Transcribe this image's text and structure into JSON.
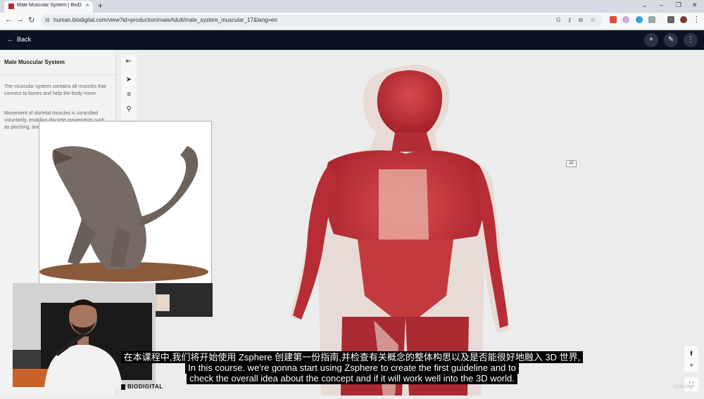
{
  "browser": {
    "tab_title": "Male Muscular System | BioDigital",
    "tab_close": "×",
    "new_tab": "+",
    "url": "human.biodigital.com/view?id=production/maleAdult/male_system_muscular_17&lang=en",
    "nav": {
      "back": "←",
      "forward": "→",
      "reload": "↻"
    },
    "window_controls": {
      "dropdown": "⌄",
      "minimize": "–",
      "maximize": "❐",
      "close": "✕"
    }
  },
  "appbar": {
    "back_label": "Back",
    "back_icon": "←",
    "plus_icon": "+",
    "tools_icon": "✎",
    "more_icon": "⋮"
  },
  "sidebar": {
    "title": "Male Muscular System",
    "paragraphs": [
      "The muscular system contains all muscles that connect to bones and help the body move.",
      "Movement of skeletal muscles is controlled voluntarily, enabling discrete movements such as pinching, and continuous movements su..."
    ]
  },
  "tools": [
    "⇤",
    "➤",
    "≡",
    "⚲",
    "●"
  ],
  "viewer": {
    "all_label": "All",
    "controls": {
      "reset": "⌖",
      "fullscreen": "⛶",
      "expand": "⬆"
    }
  },
  "brand": "BIODIGITAL",
  "subtitles": {
    "cn": "在本课程中,我们将开始使用 Zsphere 创建第一份指南,并检查有关概念的整体构思以及是否能很好地融入 3D 世界,",
    "en1": "In this course. we're gonna start using Zsphere to create the first guideline and to",
    "en2": "check the overall idea about the concept and if it will work well into the 3D world."
  },
  "watermark": "Udemy",
  "colors": {
    "appbar": "#0c1424",
    "muscle": "#c8323a",
    "skin": "#e7cfc8"
  }
}
